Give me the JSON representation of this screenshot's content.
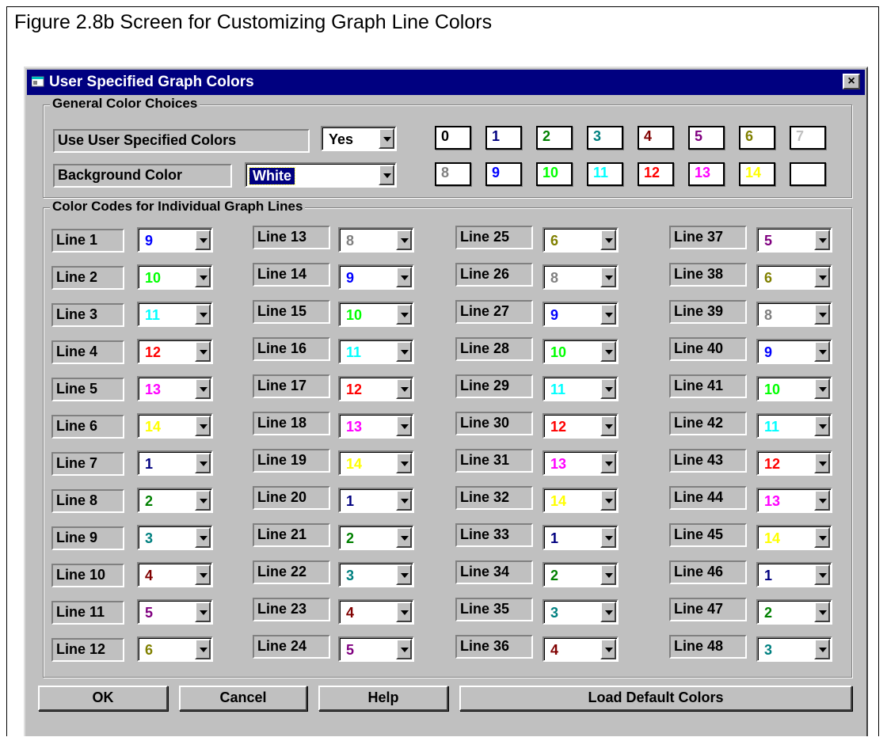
{
  "caption": "Figure 2.8b  Screen for Customizing Graph Line Colors",
  "window": {
    "title": "User Specified Graph Colors",
    "icon": "app-window-icon",
    "close_label": "×"
  },
  "general": {
    "group_title": "General Color Choices",
    "use_user_label": "Use User Specified Colors",
    "use_user_value": "Yes",
    "background_label": "Background Color",
    "background_value": "White"
  },
  "palette": [
    {
      "code": "0",
      "color": "#000000"
    },
    {
      "code": "1",
      "color": "#000080"
    },
    {
      "code": "2",
      "color": "#008000"
    },
    {
      "code": "3",
      "color": "#008080"
    },
    {
      "code": "4",
      "color": "#800000"
    },
    {
      "code": "5",
      "color": "#800080"
    },
    {
      "code": "6",
      "color": "#808000"
    },
    {
      "code": "7",
      "color": "#c0c0c0"
    },
    {
      "code": "8",
      "color": "#808080"
    },
    {
      "code": "9",
      "color": "#0000ff"
    },
    {
      "code": "10",
      "color": "#00ff00"
    },
    {
      "code": "11",
      "color": "#00ffff"
    },
    {
      "code": "12",
      "color": "#ff0000"
    },
    {
      "code": "13",
      "color": "#ff00ff"
    },
    {
      "code": "14",
      "color": "#ffff00"
    },
    {
      "code": "",
      "color": "#ffffff"
    }
  ],
  "lines": {
    "group_title": "Color Codes for Individual Graph Lines",
    "items": [
      {
        "label": "Line 1",
        "value": "9"
      },
      {
        "label": "Line 2",
        "value": "10"
      },
      {
        "label": "Line 3",
        "value": "11"
      },
      {
        "label": "Line 4",
        "value": "12"
      },
      {
        "label": "Line 5",
        "value": "13"
      },
      {
        "label": "Line 6",
        "value": "14"
      },
      {
        "label": "Line 7",
        "value": "1"
      },
      {
        "label": "Line 8",
        "value": "2"
      },
      {
        "label": "Line 9",
        "value": "3"
      },
      {
        "label": "Line 10",
        "value": "4"
      },
      {
        "label": "Line 11",
        "value": "5"
      },
      {
        "label": "Line 12",
        "value": "6"
      },
      {
        "label": "Line 13",
        "value": "8"
      },
      {
        "label": "Line 14",
        "value": "9"
      },
      {
        "label": "Line 15",
        "value": "10"
      },
      {
        "label": "Line 16",
        "value": "11"
      },
      {
        "label": "Line 17",
        "value": "12"
      },
      {
        "label": "Line 18",
        "value": "13"
      },
      {
        "label": "Line 19",
        "value": "14"
      },
      {
        "label": "Line 20",
        "value": "1"
      },
      {
        "label": "Line 21",
        "value": "2"
      },
      {
        "label": "Line 22",
        "value": "3"
      },
      {
        "label": "Line 23",
        "value": "4"
      },
      {
        "label": "Line 24",
        "value": "5"
      },
      {
        "label": "Line 25",
        "value": "6"
      },
      {
        "label": "Line 26",
        "value": "8"
      },
      {
        "label": "Line 27",
        "value": "9"
      },
      {
        "label": "Line 28",
        "value": "10"
      },
      {
        "label": "Line 29",
        "value": "11"
      },
      {
        "label": "Line 30",
        "value": "12"
      },
      {
        "label": "Line 31",
        "value": "13"
      },
      {
        "label": "Line 32",
        "value": "14"
      },
      {
        "label": "Line 33",
        "value": "1"
      },
      {
        "label": "Line 34",
        "value": "2"
      },
      {
        "label": "Line 35",
        "value": "3"
      },
      {
        "label": "Line 36",
        "value": "4"
      },
      {
        "label": "Line 37",
        "value": "5"
      },
      {
        "label": "Line 38",
        "value": "6"
      },
      {
        "label": "Line 39",
        "value": "8"
      },
      {
        "label": "Line 40",
        "value": "9"
      },
      {
        "label": "Line 41",
        "value": "10"
      },
      {
        "label": "Line 42",
        "value": "11"
      },
      {
        "label": "Line 43",
        "value": "12"
      },
      {
        "label": "Line 44",
        "value": "13"
      },
      {
        "label": "Line 45",
        "value": "14"
      },
      {
        "label": "Line 46",
        "value": "1"
      },
      {
        "label": "Line 47",
        "value": "2"
      },
      {
        "label": "Line 48",
        "value": "3"
      }
    ]
  },
  "buttons": {
    "ok": "OK",
    "cancel": "Cancel",
    "help": "Help",
    "load_defaults": "Load Default Colors"
  }
}
